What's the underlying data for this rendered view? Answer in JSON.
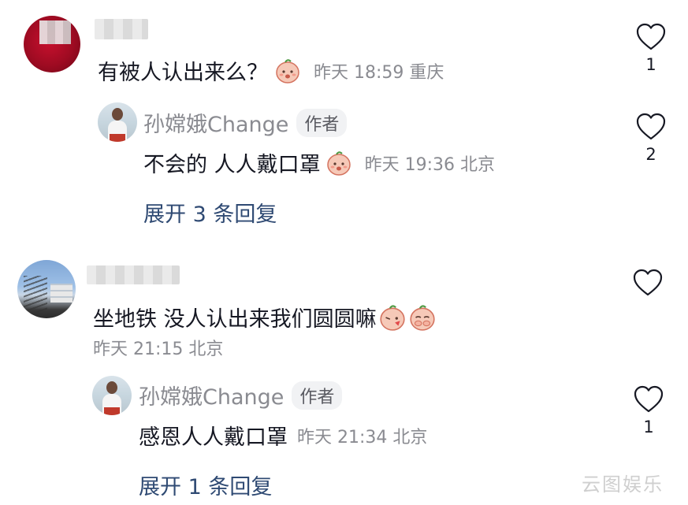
{
  "comments": [
    {
      "text": "有被人认出来么？",
      "meta": "昨天 18:59 重庆",
      "likes": "1",
      "reply": {
        "name": "孙嫦娥Change",
        "tag": "作者",
        "text": "不会的 人人戴口罩",
        "meta": "昨天 19:36 北京",
        "likes": "2"
      },
      "expand": "展开 3 条回复"
    },
    {
      "text": "坐地铁 没人认出来我们圆圆嘛",
      "meta": "昨天 21:15 北京",
      "reply": {
        "name": "孙嫦娥Change",
        "tag": "作者",
        "text": "感恩人人戴口罩",
        "meta": "昨天 21:34 北京",
        "likes": "1"
      },
      "expand": "展开 1 条回复"
    }
  ],
  "watermark": "云图娱乐",
  "icons": {
    "like": "heart-outline-icon",
    "emoji": "peach-face-icon"
  }
}
